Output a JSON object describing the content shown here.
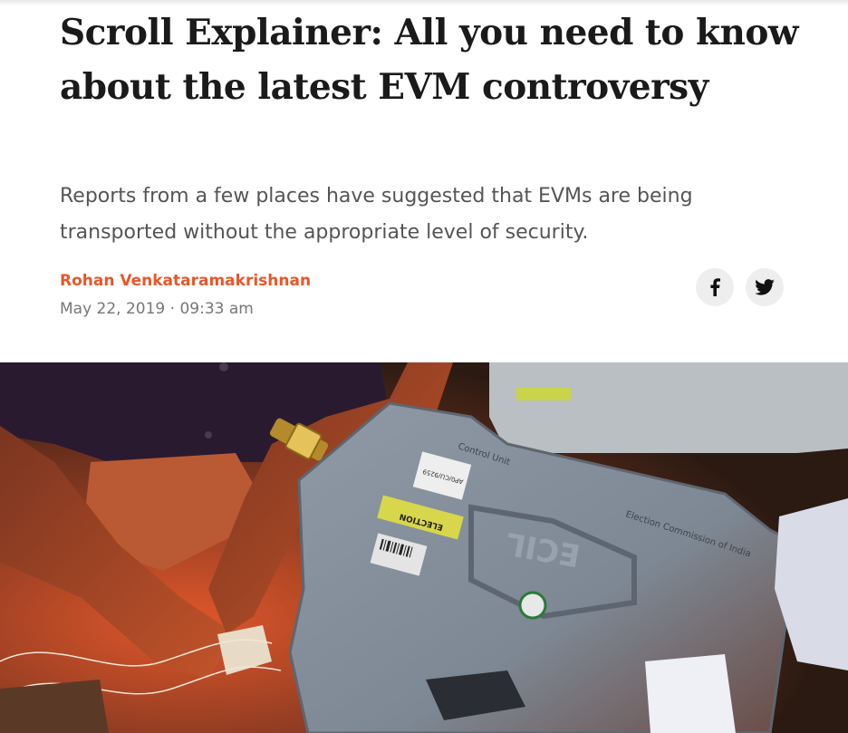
{
  "article": {
    "headline": "Scroll Explainer: All you need to know about the latest EVM controversy",
    "summary": "Reports from a few places have suggested that EVMs are being transported without the appropriate level of security.",
    "author": "Rohan Venkataramakrishnan",
    "date": "May 22, 2019",
    "separator": "·",
    "time": "09:33 am"
  },
  "share": {
    "icons": [
      "facebook-icon",
      "twitter-icon"
    ]
  },
  "hero_image": {
    "evm_labels": {
      "control_unit": "Control Unit",
      "commission": "Election Commission of India",
      "brand": "ECIL",
      "sticker_election": "ELECTION",
      "sticker_code": "9B/12/AP0/CU/060",
      "tag_code": "AP0/CU/9259"
    }
  },
  "colors": {
    "author": "#e8572a",
    "headline": "#1a1a1a",
    "summary": "#555555",
    "meta": "#777777",
    "share_bg": "#eeeeee"
  }
}
